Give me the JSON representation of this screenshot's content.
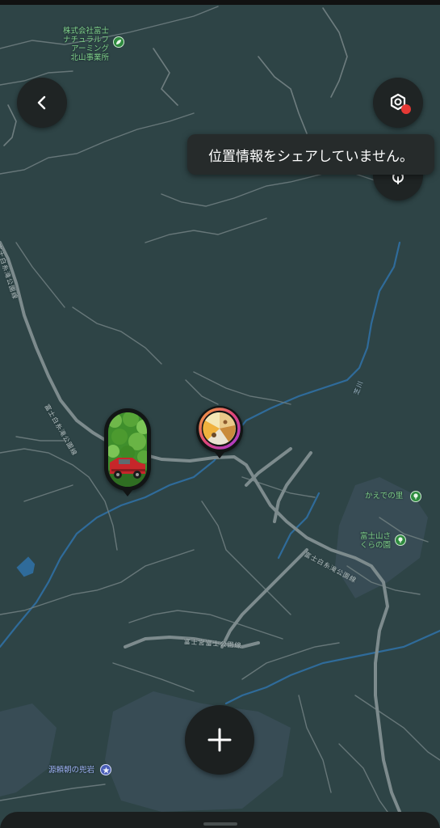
{
  "tooltip": {
    "text": "位置情報をシェアしていません。"
  },
  "poi": {
    "company_line1": "株式会社富士",
    "company_line2": "ナチュラルフ",
    "company_line3": "アーミング",
    "company_line4": "北山事業所",
    "kaede": "かえでの里",
    "sakura_line1": "富士山さ",
    "sakura_line2": "くらの園",
    "yoritomo": "源頼朝の兜岩"
  },
  "roads": {
    "shiraito_left": "富士白糸滝公園線",
    "shiraito_top": "富士白糸滝公園線",
    "shiraito_right": "富士白糸滝公園線",
    "sengen": "富士宮富士公園線",
    "river": "芝川"
  },
  "icons": {
    "back": "chevron-left-icon",
    "layers": "location-settings-icon",
    "compass": "locate-icon",
    "add": "plus-icon"
  },
  "colors": {
    "map_bg": "#2e4446",
    "road": "#7d8b8d",
    "water": "#2f6b9a",
    "tooltip_bg": "#262b2b",
    "alert_dot": "#e53935",
    "poi_green": "#7fd08a",
    "poi_blue": "#9fb2f5"
  }
}
